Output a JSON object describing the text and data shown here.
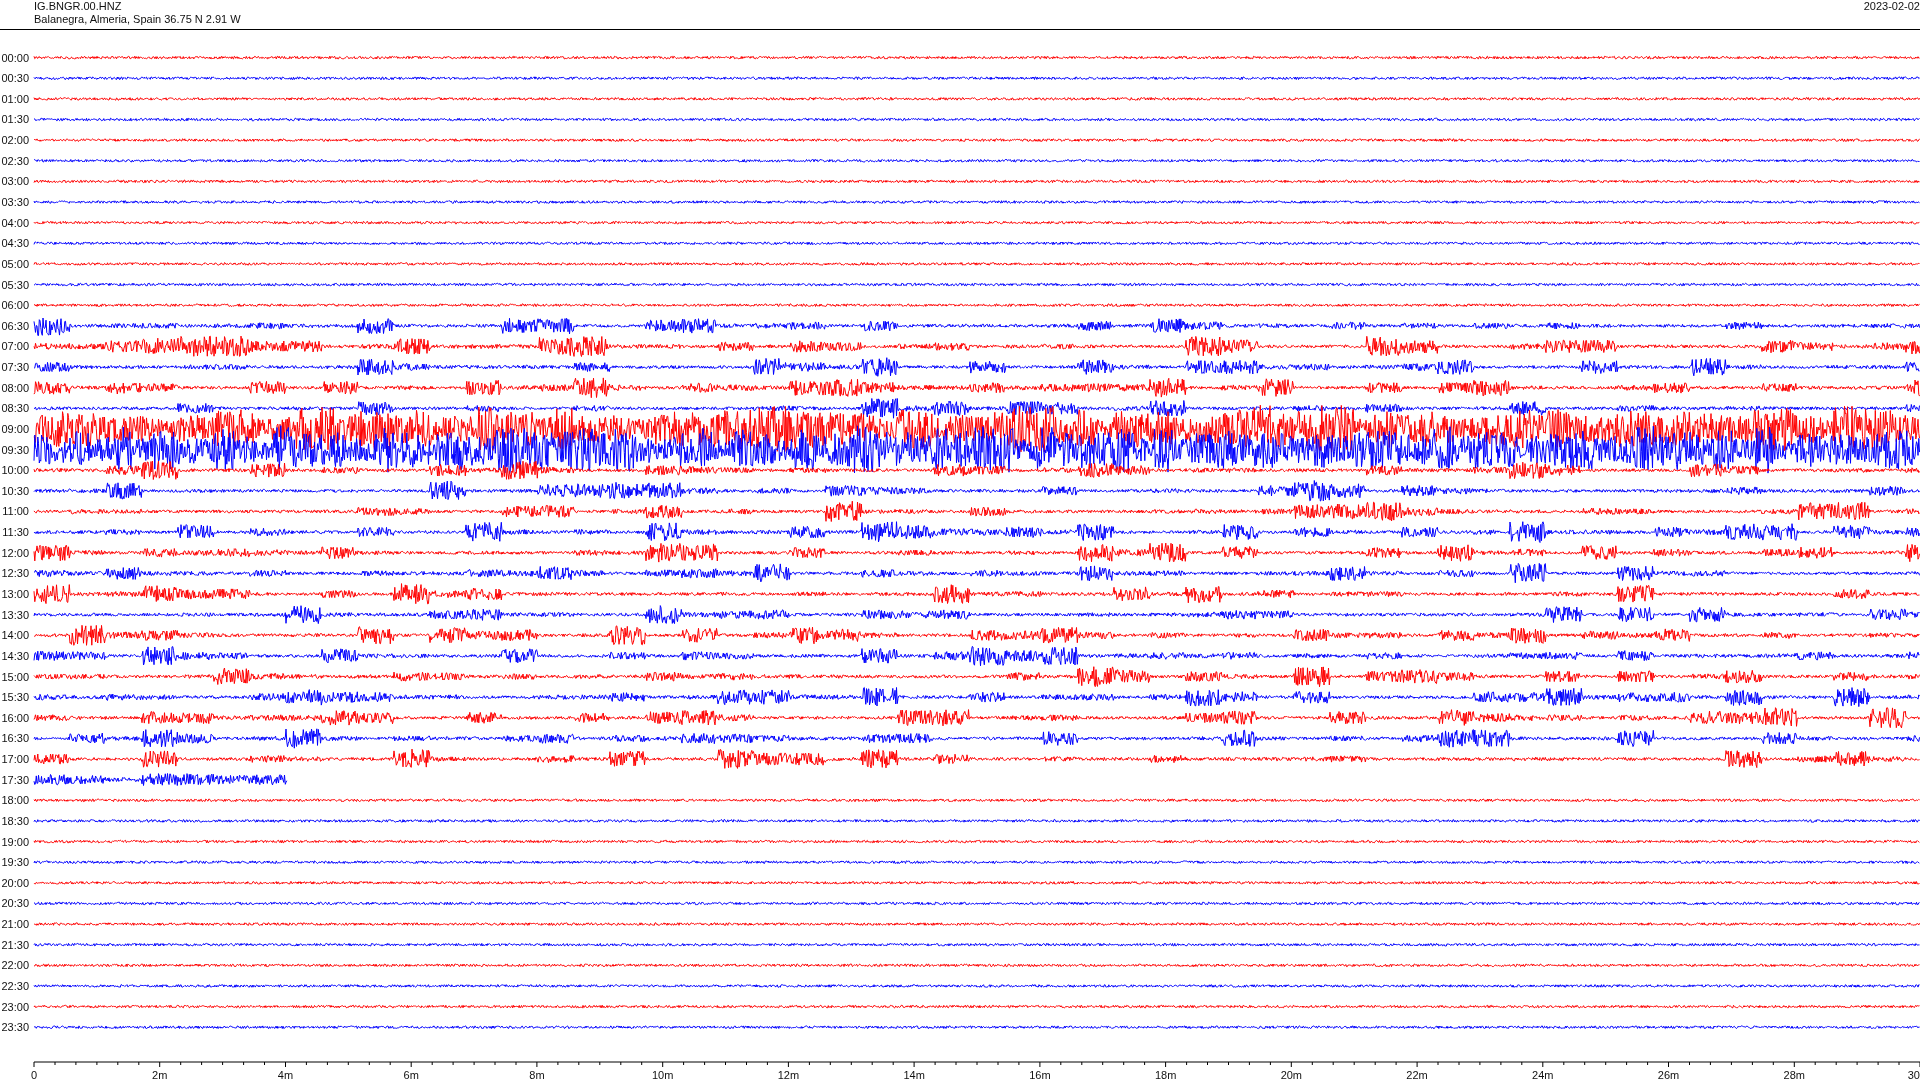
{
  "header": {
    "station_code": "IG.BNGR.00.HNZ",
    "location": "Balanegra, Almeria, Spain  36.75 N 2.91 W",
    "date": "2023-02-02"
  },
  "rows": [
    {
      "label": "00:00",
      "color": "#ff0000",
      "kind": "quiet"
    },
    {
      "label": "00:30",
      "color": "#0000ff",
      "kind": "quiet"
    },
    {
      "label": "01:00",
      "color": "#ff0000",
      "kind": "quiet"
    },
    {
      "label": "01:30",
      "color": "#0000ff",
      "kind": "quiet"
    },
    {
      "label": "02:00",
      "color": "#ff0000",
      "kind": "quiet"
    },
    {
      "label": "02:30",
      "color": "#0000ff",
      "kind": "quiet"
    },
    {
      "label": "03:00",
      "color": "#ff0000",
      "kind": "quiet"
    },
    {
      "label": "03:30",
      "color": "#0000ff",
      "kind": "quiet"
    },
    {
      "label": "04:00",
      "color": "#ff0000",
      "kind": "quiet"
    },
    {
      "label": "04:30",
      "color": "#0000ff",
      "kind": "quiet"
    },
    {
      "label": "05:00",
      "color": "#ff0000",
      "kind": "quiet"
    },
    {
      "label": "05:30",
      "color": "#0000ff",
      "kind": "quiet"
    },
    {
      "label": "06:00",
      "color": "#ff0000",
      "kind": "quiet"
    },
    {
      "label": "06:30",
      "color": "#0000ff",
      "kind": "moderate"
    },
    {
      "label": "07:00",
      "color": "#ff0000",
      "kind": "moderate"
    },
    {
      "label": "07:30",
      "color": "#0000ff",
      "kind": "moderate"
    },
    {
      "label": "08:00",
      "color": "#ff0000",
      "kind": "moderate"
    },
    {
      "label": "08:30",
      "color": "#0000ff",
      "kind": "moderate"
    },
    {
      "label": "09:00",
      "color": "#ff0000",
      "kind": "strong"
    },
    {
      "label": "09:30",
      "color": "#0000ff",
      "kind": "strong"
    },
    {
      "label": "10:00",
      "color": "#ff0000",
      "kind": "moderate"
    },
    {
      "label": "10:30",
      "color": "#0000ff",
      "kind": "moderate"
    },
    {
      "label": "11:00",
      "color": "#ff0000",
      "kind": "moderate"
    },
    {
      "label": "11:30",
      "color": "#0000ff",
      "kind": "moderate"
    },
    {
      "label": "12:00",
      "color": "#ff0000",
      "kind": "moderate"
    },
    {
      "label": "12:30",
      "color": "#0000ff",
      "kind": "moderate"
    },
    {
      "label": "13:00",
      "color": "#ff0000",
      "kind": "moderate"
    },
    {
      "label": "13:30",
      "color": "#0000ff",
      "kind": "moderate"
    },
    {
      "label": "14:00",
      "color": "#ff0000",
      "kind": "moderate"
    },
    {
      "label": "14:30",
      "color": "#0000ff",
      "kind": "moderate"
    },
    {
      "label": "15:00",
      "color": "#ff0000",
      "kind": "moderate"
    },
    {
      "label": "15:30",
      "color": "#0000ff",
      "kind": "moderate"
    },
    {
      "label": "16:00",
      "color": "#ff0000",
      "kind": "moderate"
    },
    {
      "label": "16:30",
      "color": "#0000ff",
      "kind": "moderate"
    },
    {
      "label": "17:00",
      "color": "#ff0000",
      "kind": "moderate"
    },
    {
      "label": "17:30",
      "color": "#0000ff",
      "kind": "partial"
    },
    {
      "label": "18:00",
      "color": "#ff0000",
      "kind": "quiet"
    },
    {
      "label": "18:30",
      "color": "#0000ff",
      "kind": "quiet"
    },
    {
      "label": "19:00",
      "color": "#ff0000",
      "kind": "quiet"
    },
    {
      "label": "19:30",
      "color": "#0000ff",
      "kind": "quiet"
    },
    {
      "label": "20:00",
      "color": "#ff0000",
      "kind": "quiet"
    },
    {
      "label": "20:30",
      "color": "#0000ff",
      "kind": "quiet"
    },
    {
      "label": "21:00",
      "color": "#ff0000",
      "kind": "quiet"
    },
    {
      "label": "21:30",
      "color": "#0000ff",
      "kind": "quiet"
    },
    {
      "label": "22:00",
      "color": "#ff0000",
      "kind": "quiet"
    },
    {
      "label": "22:30",
      "color": "#0000ff",
      "kind": "quiet"
    },
    {
      "label": "23:00",
      "color": "#ff0000",
      "kind": "quiet"
    },
    {
      "label": "23:30",
      "color": "#0000ff",
      "kind": "quiet"
    }
  ],
  "x_axis": {
    "labels": [
      "0",
      "2m",
      "4m",
      "6m",
      "8m",
      "10m",
      "12m",
      "14m",
      "16m",
      "18m",
      "20m",
      "22m",
      "24m",
      "26m",
      "28m",
      "30"
    ]
  }
}
